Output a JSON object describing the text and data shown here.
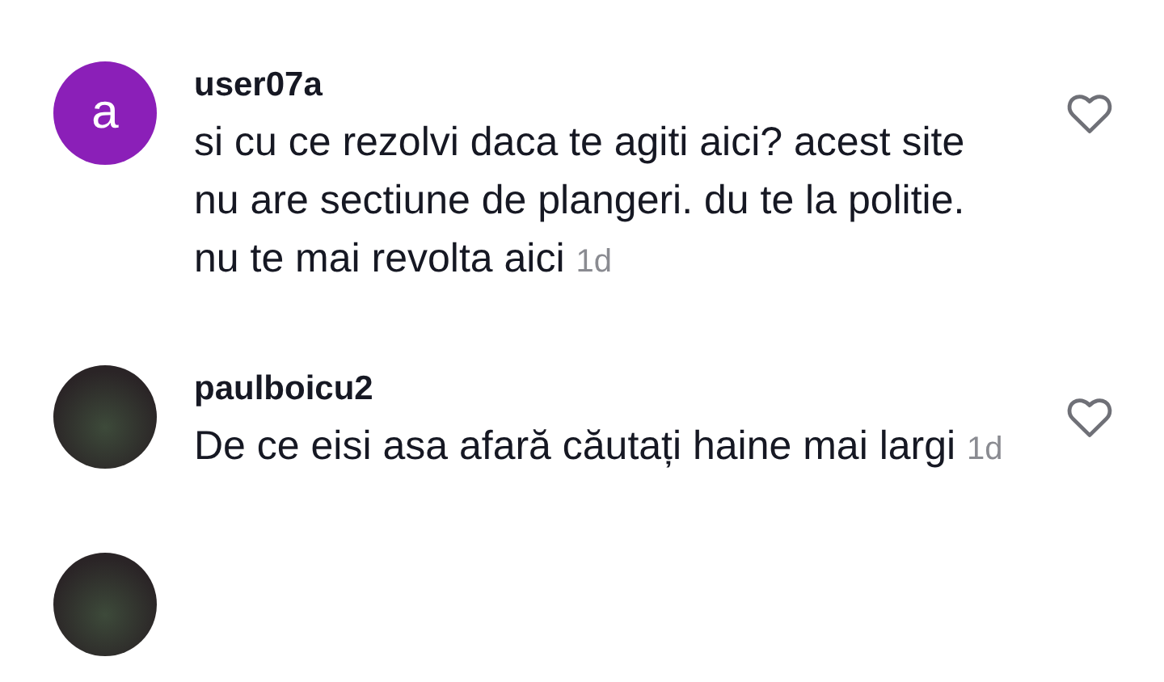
{
  "comments": [
    {
      "avatar": {
        "kind": "letter",
        "letter": "a"
      },
      "username": "user07a",
      "text": "si cu ce rezolvi daca te agiti aici? acest site nu are sectiune de plangeri. du te la politie. nu te mai revolta aici",
      "time": "1d",
      "liked": false
    },
    {
      "avatar": {
        "kind": "photo"
      },
      "username": "paulboicu2",
      "text": "De ce eisi asa afară căutați haine mai largi",
      "time": "1d",
      "liked": false
    },
    {
      "avatar": {
        "kind": "photo"
      }
    }
  ]
}
